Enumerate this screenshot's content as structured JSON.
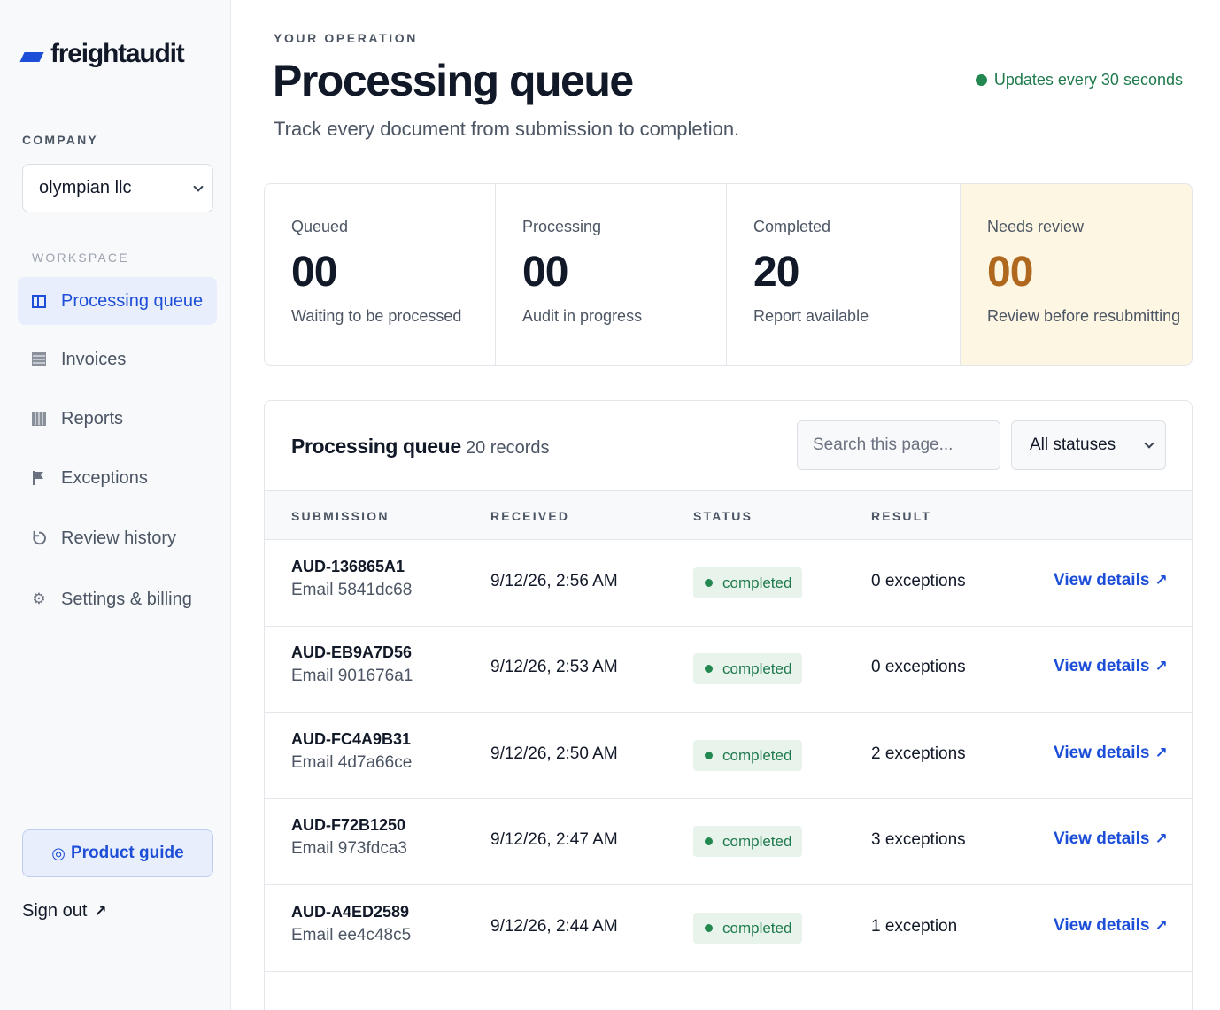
{
  "brand": {
    "name": "freightaudit",
    "accent": "#1d4ed8"
  },
  "sidebar": {
    "company_label": "COMPANY",
    "company_value": "olympian llc",
    "workspace_label": "WORKSPACE",
    "items": [
      {
        "label": "Processing queue",
        "icon": "panel-icon",
        "active": true
      },
      {
        "label": "Invoices",
        "icon": "invoice-icon"
      },
      {
        "label": "Reports",
        "icon": "reports-icon"
      },
      {
        "label": "Exceptions",
        "icon": "flag-icon"
      },
      {
        "label": "Review history",
        "icon": "history-icon"
      },
      {
        "label": "Settings & billing",
        "icon": "gear-icon"
      }
    ],
    "guide_label": "Product guide",
    "signout_label": "Sign out"
  },
  "header": {
    "eyebrow": "YOUR OPERATION",
    "title": "Processing queue",
    "subtitle": "Track every document from submission to completion.",
    "live_text": "Updates every 30 seconds",
    "live_color": "#22884f"
  },
  "stats": [
    {
      "label": "Queued",
      "value": "00",
      "desc": "Waiting to be processed"
    },
    {
      "label": "Processing",
      "value": "00",
      "desc": "Audit in progress"
    },
    {
      "label": "Completed",
      "value": "20",
      "desc": "Report available"
    },
    {
      "label": "Needs review",
      "value": "00",
      "desc": "Review before resubmitting",
      "warn_color": "#b0681e"
    }
  ],
  "queue": {
    "title": "Processing queue",
    "count": "20 records",
    "search_placeholder": "Search this page...",
    "status_filter": "All statuses",
    "columns": [
      "SUBMISSION",
      "RECEIVED",
      "STATUS",
      "RESULT"
    ],
    "link_label": "View details",
    "rows": [
      {
        "id": "AUD-136865A1",
        "source": "Email 5841dc68",
        "received": "9/12/26, 2:56 AM",
        "status": "completed",
        "result": "0 exceptions"
      },
      {
        "id": "AUD-EB9A7D56",
        "source": "Email 901676a1",
        "received": "9/12/26, 2:53 AM",
        "status": "completed",
        "result": "0 exceptions"
      },
      {
        "id": "AUD-FC4A9B31",
        "source": "Email 4d7a66ce",
        "received": "9/12/26, 2:50 AM",
        "status": "completed",
        "result": "2 exceptions"
      },
      {
        "id": "AUD-F72B1250",
        "source": "Email 973fdca3",
        "received": "9/12/26, 2:47 AM",
        "status": "completed",
        "result": "3 exceptions"
      },
      {
        "id": "AUD-A4ED2589",
        "source": "Email ee4c48c5",
        "received": "9/12/26, 2:44 AM",
        "status": "completed",
        "result": "1 exception"
      }
    ]
  }
}
